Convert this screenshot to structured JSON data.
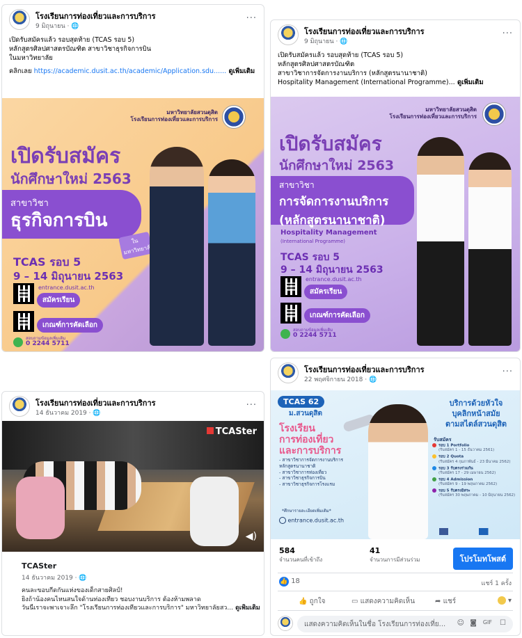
{
  "page_name": "โรงเรียนการท่องเที่ยวและการบริการ",
  "more_label": "...",
  "post1": {
    "date": "9 มิถุนายน · 🌐",
    "lines": [
      "เปิดรับสมัครแล้ว รอบสุดท้าย (TCAS รอบ 5)",
      "หลักสูตรศิลปศาสตรบัณฑิต สาขาวิชาธุรกิจการบิน",
      "ในมหาวิทยาลัย"
    ],
    "link_prefix": "คลิกเลย ",
    "link": "https://academic.dusit.ac.th/academic/Application.sdu......",
    "see_more": " ดูเพิ่มเติม",
    "poster": {
      "uni": "มหาวิทยาลัยสวนดุสิต",
      "school": "โรงเรียนการท่องเที่ยวและการบริการ",
      "title": "เปิดรับสมัคร",
      "subtitle": "นักศึกษาใหม่ 2563",
      "major_prefix": "สาขาวิชา",
      "major": "ธุรกิจการบิน",
      "tag": "ใน มหาวิทยาลัย",
      "round": "TCAS รอบ 5",
      "dates": "9 – 14 มิถุนายน 2563",
      "website": "entrance.dusit.ac.th",
      "apply": "สมัครเรียน",
      "criteria": "เกณฑ์การคัดเลือก",
      "contact": "สอบถามข้อมูลเพิ่มเติม",
      "phone": "0 2244 5711"
    }
  },
  "post2": {
    "date": "9 มิถุนายน · 🌐",
    "lines": [
      "เปิดรับสมัครแล้ว รอบสุดท้าย (TCAS รอบ 5)",
      "หลักสูตรศิลปศาสตรบัณฑิต",
      "สาขาวิชาการจัดการงานบริการ (หลักสูตรนานาชาติ)"
    ],
    "last_line": "Hospitality Management (International Programme)...",
    "see_more": " ดูเพิ่มเติม",
    "poster": {
      "uni": "มหาวิทยาลัยสวนดุสิต",
      "school": "โรงเรียนการท่องเที่ยวและการบริการ",
      "title": "เปิดรับสมัคร",
      "subtitle": "นักศึกษาใหม่ 2563",
      "major_prefix": "สาขาวิชา",
      "major_1": "การจัดการงานบริการ",
      "major_2": "(หลักสูตรนานาชาติ)",
      "en_1": "Hospitality Management",
      "en_2": "(International Programme)",
      "round": "TCAS รอบ 5",
      "dates": "9 – 14 มิถุนายน 2563",
      "website": "entrance.dusit.ac.th",
      "apply": "สมัครเรียน",
      "criteria": "เกณฑ์การคัดเลือก",
      "contact": "สอบถามข้อมูลเพิ่มเติม",
      "phone": "0 2244 5711"
    }
  },
  "post3": {
    "date": "14 ธันวาคม 2019 · 🌐",
    "video_brand": "TCASter",
    "card_title": "TCASter",
    "card_date": "14 ธันวาคม 2019 · 🌐",
    "lines": [
      "คนละขอบกีดกันแห่งของเด็กสายศิลป์!",
      "ยิงถ้าน้องคนไหนสนใจด้านท่องเที่ยว ชอบงานบริการ ต้องห้ามพลาด"
    ],
    "last_line": "วันนี้เราจะพาเจาะลึก \"โรงเรียนการท่องเที่ยวและการบริการ\" มหาวิทยาลัยสว...",
    "see_more": " ดูเพิ่มเติม"
  },
  "post4": {
    "date": "22 พฤศจิกายน 2018 · 🌐",
    "poster": {
      "badge": "TCAS 62",
      "badge_sub": "ม.สวนดุสิต",
      "school_1": "โรงเรียน",
      "school_2": "การท่องเที่ยว",
      "school_3": "และการบริการ",
      "quote_1": "บริการด้วยหัวใจ",
      "quote_2": "บุคลิกหน้าสมัย",
      "quote_3": "ตามสไตล์สวนดุสิต",
      "majors": [
        "- สาขาวิชาการจัดการงานบริการ",
        "  หลักสูตรนานาชาติ",
        "- สาขาวิชาการท่องเที่ยว",
        "- สาขาวิชาธุรกิจการบิน",
        "- สาขาวิชาธุรกิจการโรงแรม"
      ],
      "note": "*ศึกษารายละเอียดเพิ่มเติม*",
      "website": "entrance.dusit.ac.th",
      "apply_title": "รับสมัคร",
      "rounds": [
        {
          "name": "รอบ 1 Portfolio",
          "dates": "(รับสมัคร 1 - 15 ธันวาคม 2561)",
          "color": "#e53935"
        },
        {
          "name": "รอบ 2 Quota",
          "dates": "(รับสมัคร 4 กุมภาพันธ์ - 23 มีนาคม 2562)",
          "color": "#fbc02d"
        },
        {
          "name": "รอบ 3 รับตรงร่วมกัน",
          "dates": "(รับสมัคร 17 - 29 เมษายน 2562)",
          "color": "#1e88e5"
        },
        {
          "name": "รอบ 4 Admission",
          "dates": "(รับสมัคร 9 - 19 พฤษภาคม 2562)",
          "color": "#43a047"
        },
        {
          "name": "รอบ 5 รับตรงอิสระ",
          "dates": "(รับสมัคร 30 พฤษภาคม - 10 มิถุนายน 2562)",
          "color": "#8e24aa"
        }
      ]
    },
    "reach_num": "584",
    "reach_label": "จำนวนคนที่เข้าถึง",
    "engage_num": "41",
    "engage_label": "จำนวนการมีส่วนร่วม",
    "promote": "โปรโมทโพสต์",
    "likes": "18",
    "shares": "แชร์ 1 ครั้ง",
    "like_btn": "ถูกใจ",
    "comment_btn": "แสดงความคิดเห็น",
    "share_btn": "แชร์",
    "comment_placeholder": "แสดงความคิดเห็นในชื่อ โรงเรียนการท่องเที่ย..."
  }
}
